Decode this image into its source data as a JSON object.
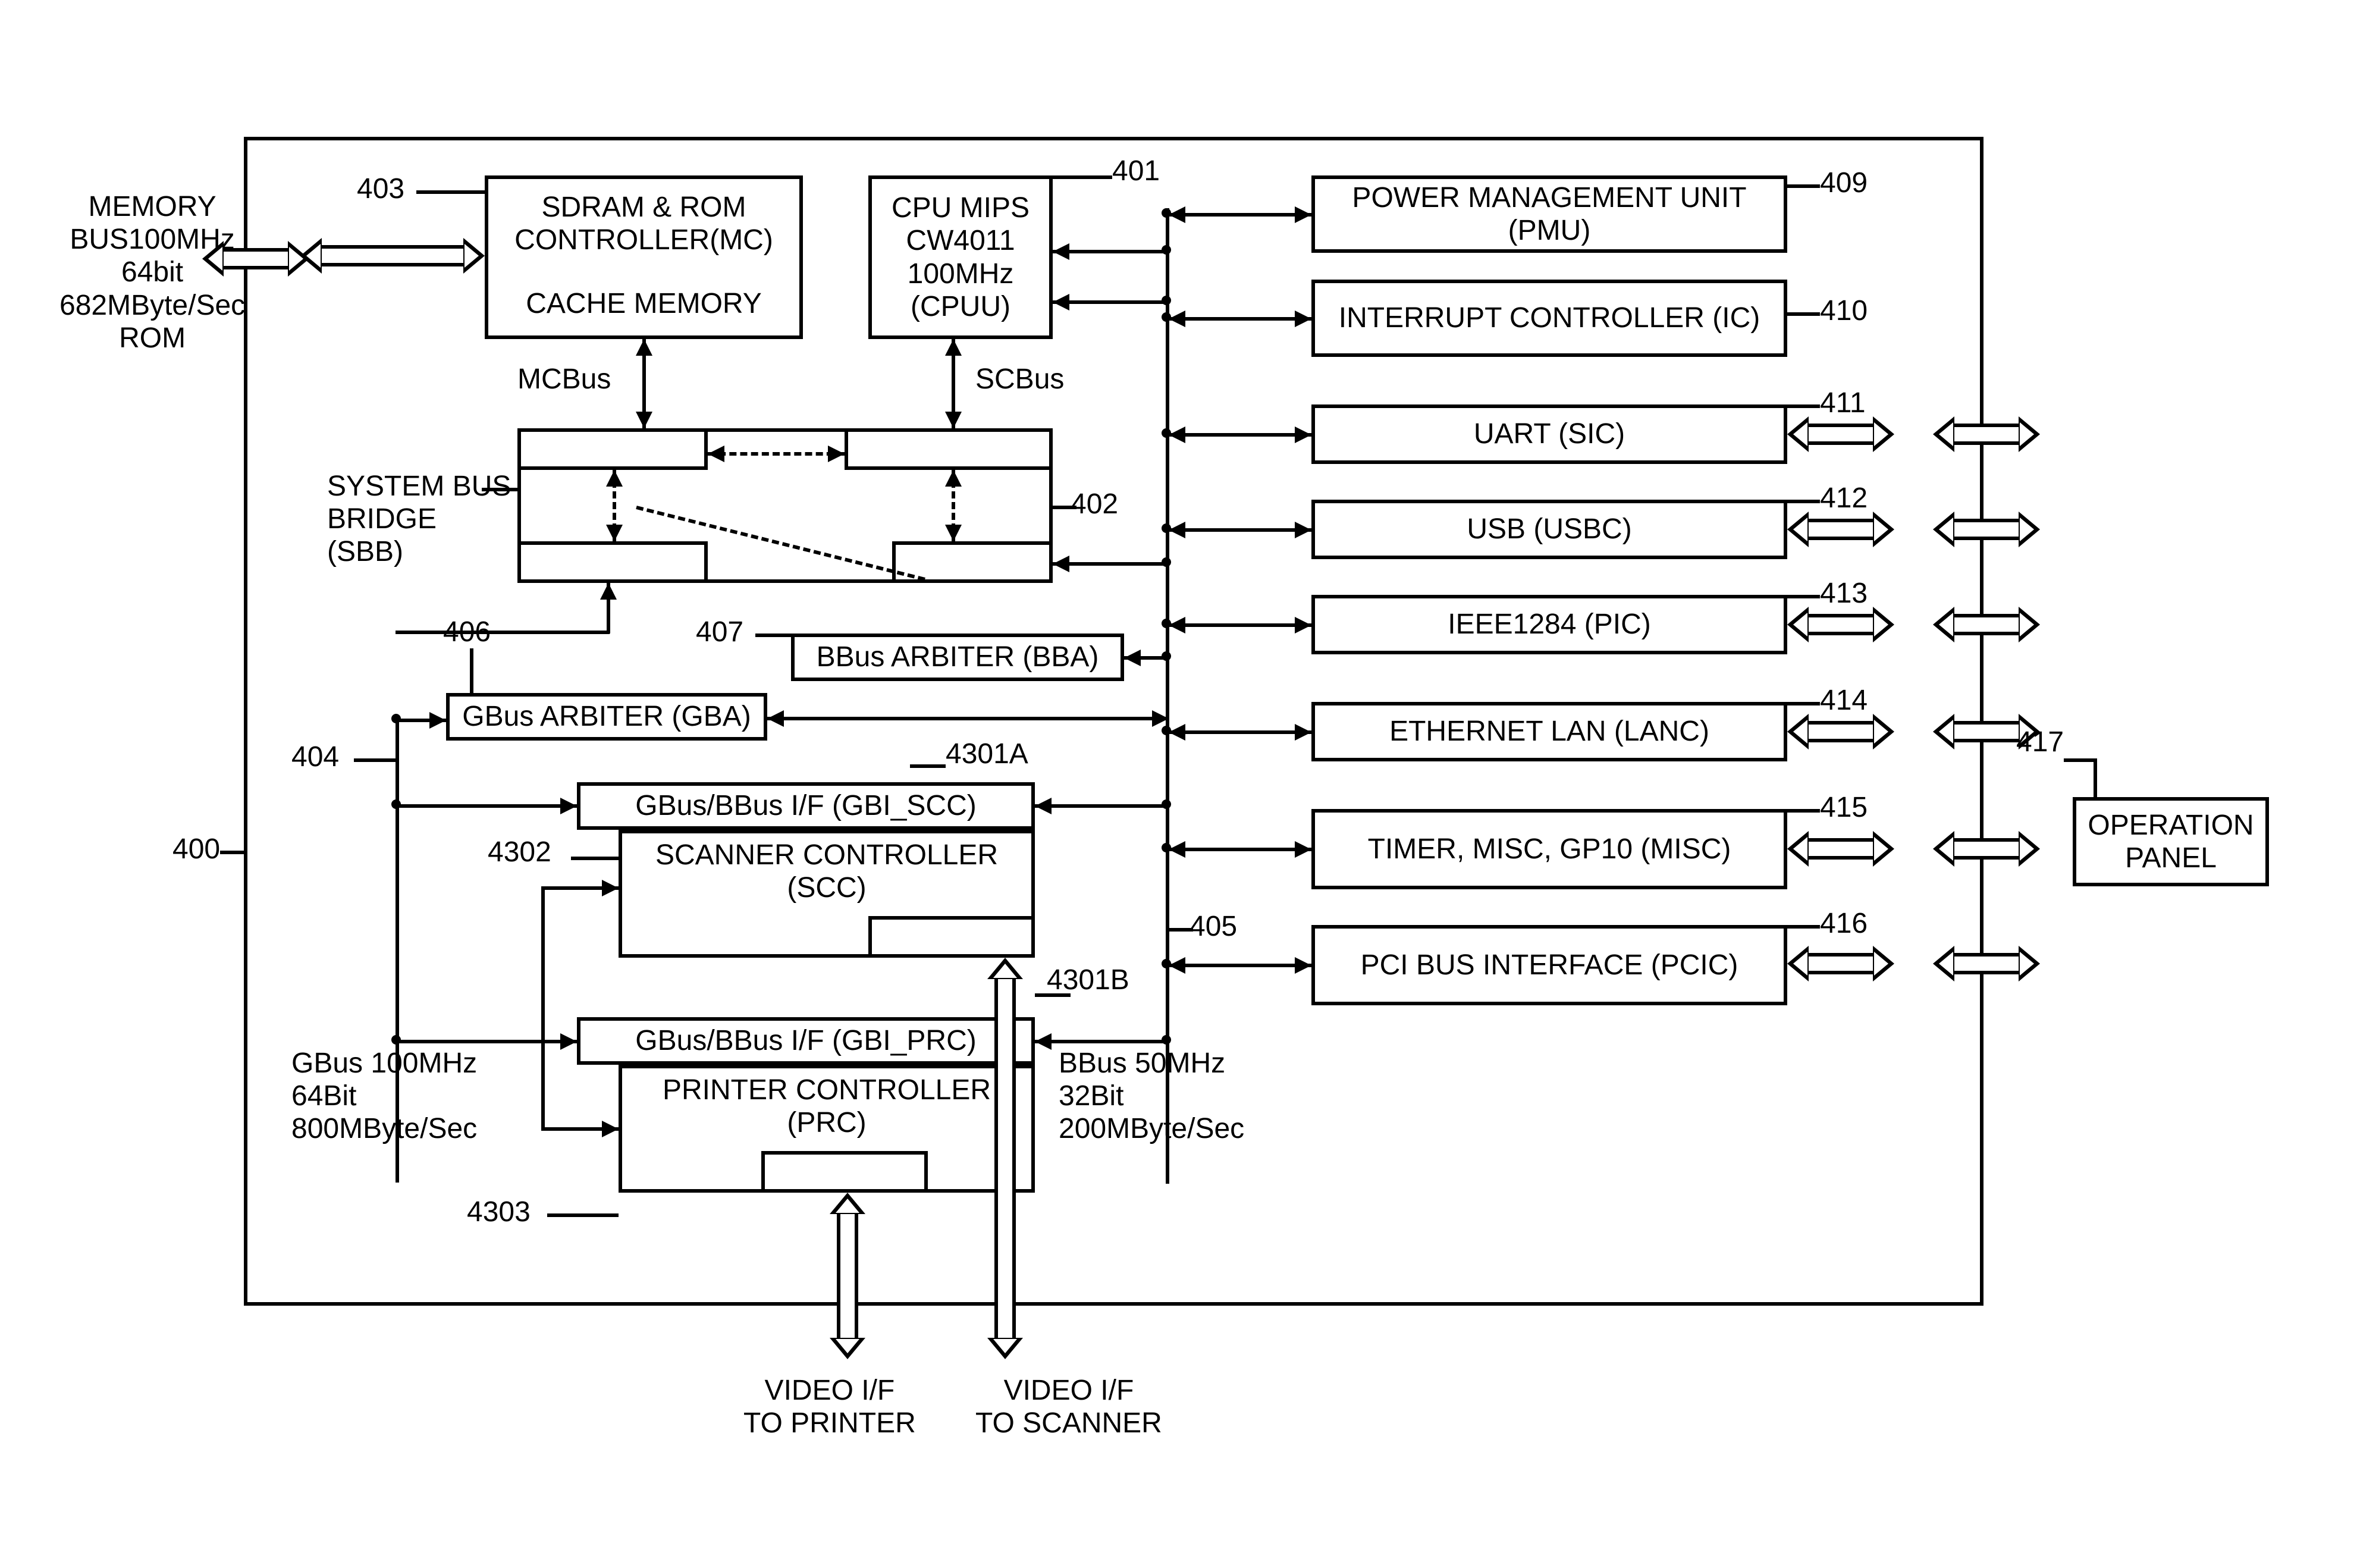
{
  "external": {
    "memory_bus_label": "MEMORY\nBUS100MHz\n64bit\n682MByte/Sec\nROM",
    "operation_panel": "OPERATION\nPANEL",
    "op_ref": "417",
    "video_printer": "VIDEO I/F\nTO PRINTER",
    "video_scanner": "VIDEO I/F\nTO SCANNER"
  },
  "chip": {
    "ref": "400",
    "mc": {
      "top": "SDRAM & ROM\nCONTROLLER(MC)",
      "bottom": "CACHE MEMORY",
      "ref": "403"
    },
    "cpu": {
      "text": "CPU MIPS\nCW4011\n100MHz\n(CPUU)",
      "ref": "401"
    },
    "sbb": {
      "label": "SYSTEM BUS\nBRIDGE\n(SBB)",
      "ref": "402"
    },
    "gba": {
      "text": "GBus ARBITER (GBA)",
      "ref": "406"
    },
    "bba": {
      "text": "BBus ARBITER (BBA)",
      "ref": "407"
    },
    "gbi_scc": {
      "text": "GBus/BBus I/F (GBI_SCC)",
      "ref": "4301A"
    },
    "scc": {
      "text": "SCANNER CONTROLLER\n(SCC)",
      "ref": "4302"
    },
    "gbi_prc": {
      "text": "GBus/BBus I/F (GBI_PRC)",
      "ref": "4301B"
    },
    "prc": {
      "text": "PRINTER CONTROLLER\n(PRC)",
      "ref": "4303"
    },
    "bus_mc": "MCBus",
    "bus_sc": "SCBus",
    "gbus_ref": "404",
    "bbus_ref": "405",
    "gbus_spec": "GBus 100MHz\n64Bit\n800MByte/Sec",
    "bbus_spec": "BBus 50MHz\n32Bit\n200MByte/Sec"
  },
  "right": {
    "pmu": {
      "text": "POWER MANAGEMENT UNIT\n(PMU)",
      "ref": "409"
    },
    "ic": {
      "text": "INTERRUPT CONTROLLER\n(IC)",
      "ref": "410"
    },
    "uart": {
      "text": "UART (SIC)",
      "ref": "411"
    },
    "usb": {
      "text": "USB (USBC)",
      "ref": "412"
    },
    "ieee": {
      "text": "IEEE1284 (PIC)",
      "ref": "413"
    },
    "lan": {
      "text": "ETHERNET LAN (LANC)",
      "ref": "414"
    },
    "misc": {
      "text": "TIMER, MISC, GP10\n(MISC)",
      "ref": "415"
    },
    "pcic": {
      "text": "PCI BUS INTERFACE\n(PCIC)",
      "ref": "416"
    }
  }
}
